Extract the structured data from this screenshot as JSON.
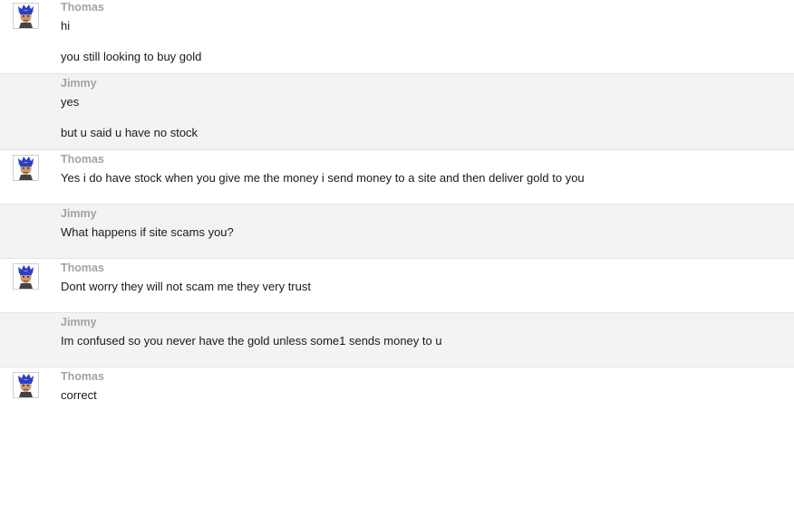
{
  "messages": [
    {
      "author": "Thomas",
      "has_avatar": true,
      "lines": [
        "hi",
        "you still looking to buy gold"
      ]
    },
    {
      "author": "Jimmy",
      "has_avatar": false,
      "lines": [
        "yes",
        "but u said u have no stock"
      ]
    },
    {
      "author": "Thomas",
      "has_avatar": true,
      "lines": [
        "Yes i do have stock when you give me the money i send money to a site and then deliver gold to you"
      ]
    },
    {
      "author": "Jimmy",
      "has_avatar": false,
      "lines": [
        "What happens if site scams you?"
      ]
    },
    {
      "author": "Thomas",
      "has_avatar": true,
      "lines": [
        "Dont worry they will not scam me they very trust"
      ]
    },
    {
      "author": "Jimmy",
      "has_avatar": false,
      "lines": [
        "Im confused so you never have the gold unless some1 sends money to u"
      ]
    },
    {
      "author": "Thomas",
      "has_avatar": true,
      "lines": [
        "correct"
      ]
    }
  ],
  "colors": {
    "author": "#a3a3a3",
    "text": "#1a1a1a",
    "alt_row": "#f3f3f3",
    "divider": "#e3e3e3",
    "avatar_hair": "#2a3fc9"
  },
  "icons": {
    "avatar": "user-avatar-icon"
  }
}
